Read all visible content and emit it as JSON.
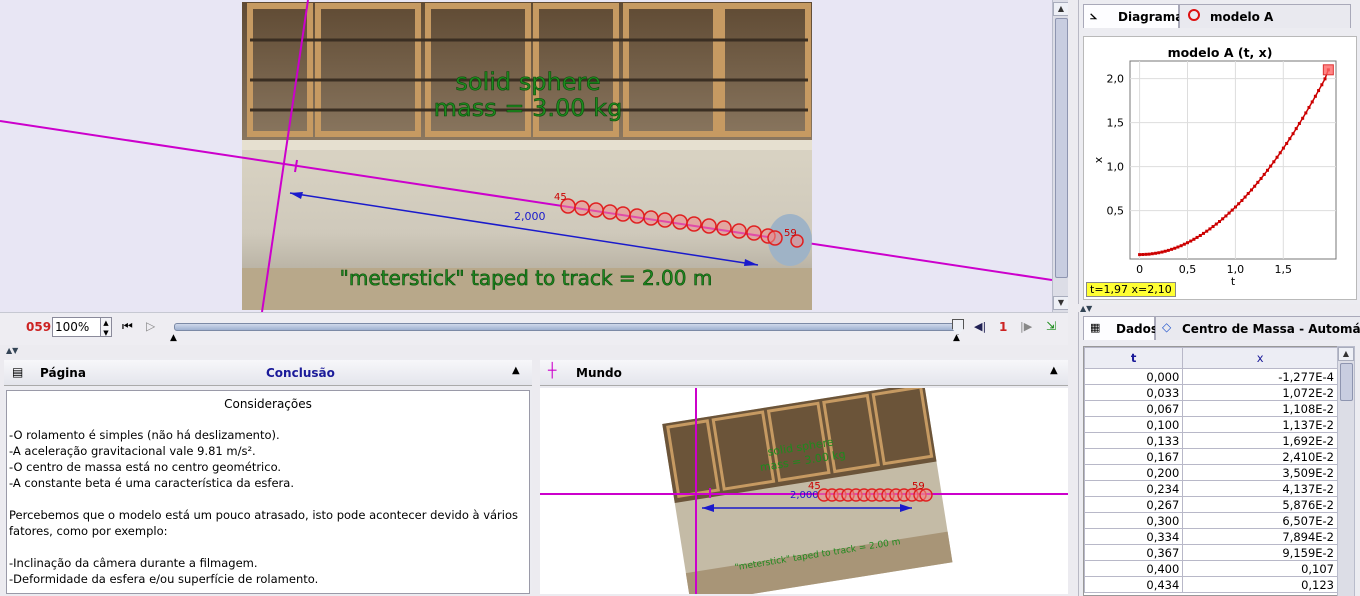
{
  "video": {
    "overlay_top_line1": "solid sphere",
    "overlay_top_line2": "mass = 3.00 kg",
    "overlay_bottom": "\"meterstick\" taped to track = 2.00 m",
    "calibration_label": "2,000",
    "point_first_label": "45",
    "point_last_label": "59"
  },
  "player": {
    "frame": "059",
    "zoom": "100%",
    "step_count": "1"
  },
  "page_panel": {
    "title": "Página",
    "tab": "Conclusão",
    "heading": "Considerações",
    "lines": [
      "-O rolamento é simples (não há deslizamento).",
      "-A aceleração gravitacional vale 9.81 m/s².",
      "-O centro de massa está no centro geométrico.",
      "-A constante beta é uma característica da esfera.",
      "",
      "Percebemos que o modelo está um pouco atrasado, isto pode acontecer devido à vários",
      "fatores, como por exemplo:",
      "",
      "-Inclinação da câmera durante a filmagem.",
      "-Deformidade da esfera e/ou superfície de rolamento."
    ]
  },
  "world_panel": {
    "title": "Mundo",
    "calibration_label": "2,000",
    "point_first_label": "45",
    "point_last_label": "59"
  },
  "plot_panel": {
    "tab_diagram": "Diagrama",
    "tab_model": "modelo A",
    "readout": "t=1,97  x=2,10"
  },
  "chart_data": {
    "type": "scatter",
    "title": "modelo A (t, x)",
    "xlabel": "t",
    "ylabel": "x",
    "xlim": [
      -0.1,
      2.05
    ],
    "ylim": [
      -0.05,
      2.2
    ],
    "x_ticks": [
      "0",
      "0,5",
      "1,0",
      "1,5"
    ],
    "y_ticks": [
      "0,5",
      "1,0",
      "1,5",
      "2,0"
    ],
    "x": [
      0.0,
      0.033,
      0.067,
      0.1,
      0.133,
      0.167,
      0.2,
      0.234,
      0.267,
      0.3,
      0.334,
      0.367,
      0.4,
      0.434,
      0.467,
      0.5,
      0.534,
      0.567,
      0.6,
      0.634,
      0.667,
      0.701,
      0.734,
      0.767,
      0.801,
      0.834,
      0.867,
      0.901,
      0.934,
      0.967,
      1.001,
      1.034,
      1.068,
      1.101,
      1.134,
      1.168,
      1.201,
      1.234,
      1.268,
      1.301,
      1.335,
      1.368,
      1.401,
      1.435,
      1.468,
      1.501,
      1.535,
      1.568,
      1.602,
      1.635,
      1.668,
      1.702,
      1.735,
      1.768,
      1.802,
      1.835,
      1.868,
      1.902,
      1.935,
      1.97
    ],
    "y": [
      0.0,
      0.001,
      0.003,
      0.005,
      0.01,
      0.015,
      0.021,
      0.029,
      0.038,
      0.048,
      0.06,
      0.072,
      0.086,
      0.101,
      0.118,
      0.135,
      0.154,
      0.174,
      0.195,
      0.217,
      0.241,
      0.266,
      0.292,
      0.319,
      0.347,
      0.376,
      0.407,
      0.439,
      0.472,
      0.506,
      0.541,
      0.578,
      0.615,
      0.654,
      0.694,
      0.735,
      0.777,
      0.821,
      0.865,
      0.911,
      0.958,
      1.006,
      1.055,
      1.106,
      1.157,
      1.21,
      1.263,
      1.318,
      1.374,
      1.432,
      1.49,
      1.549,
      1.61,
      1.672,
      1.735,
      1.799,
      1.864,
      1.93,
      1.997,
      2.1
    ],
    "series_color": "#cc0000",
    "grid": true
  },
  "data_panel": {
    "tab_data": "Dados",
    "tab_mass_center": "Centro de Massa - Automátic",
    "columns": [
      "t",
      "x"
    ],
    "rows": [
      [
        "0,000",
        "-1,277E-4"
      ],
      [
        "0,033",
        "1,072E-2"
      ],
      [
        "0,067",
        "1,108E-2"
      ],
      [
        "0,100",
        "1,137E-2"
      ],
      [
        "0,133",
        "1,692E-2"
      ],
      [
        "0,167",
        "2,410E-2"
      ],
      [
        "0,200",
        "3,509E-2"
      ],
      [
        "0,234",
        "4,137E-2"
      ],
      [
        "0,267",
        "5,876E-2"
      ],
      [
        "0,300",
        "6,507E-2"
      ],
      [
        "0,334",
        "7,894E-2"
      ],
      [
        "0,367",
        "9,159E-2"
      ],
      [
        "0,400",
        "0,107"
      ],
      [
        "0,434",
        "0,123"
      ]
    ]
  },
  "colors": {
    "axis_line": "#cc00cc",
    "calibration": "#1a1acc",
    "track_points": "#e02020",
    "overlay_text": "#1e8a1e",
    "readout_bg": "#ffff33"
  }
}
